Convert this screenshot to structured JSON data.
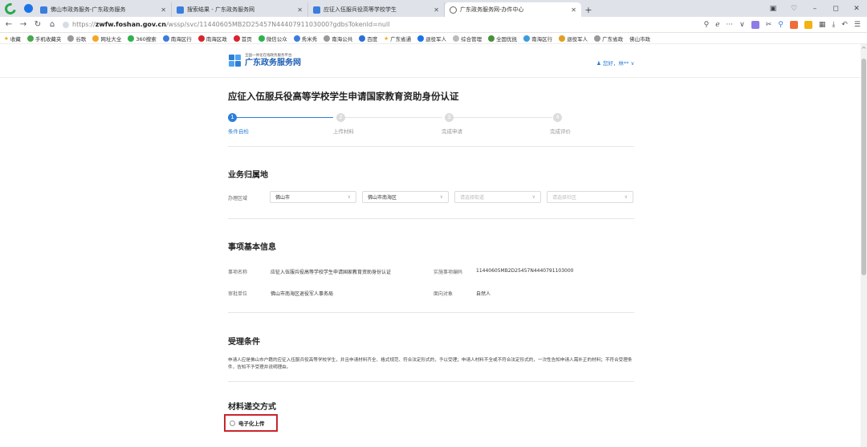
{
  "browser": {
    "tabs": [
      {
        "title": "佛山市政务服务-广东政务服务",
        "active": false
      },
      {
        "title": "搜索结果 - 广东政务服务网",
        "active": false
      },
      {
        "title": "应征入伍服兵役高等学校学生",
        "active": false
      },
      {
        "title": "广东政务服务网-办件中心",
        "active": true
      }
    ],
    "url_prefix": "https://",
    "url_host": "zwfw.foshan.gov.cn",
    "url_path": "/wssp/svc/11440605MB2D25457N4440791103000?gdbsTokenId=null",
    "bookmarks": [
      "收藏",
      "手机收藏夹",
      "谷歌",
      "网址大全",
      "360搜索",
      "南海区行",
      "南海区政",
      "首页",
      "微信公众",
      "秀米秀",
      "南海公共",
      "百度",
      "广东省通",
      "退役军人",
      "综合管理",
      "全国优抚",
      "南海区行",
      "退役军人",
      "广东省政",
      "佛山市政"
    ]
  },
  "site": {
    "logo_small": "全国一体化在线政务服务平台",
    "logo_big": "广东政务服务网",
    "user_label": "您好，林** ∨"
  },
  "page": {
    "title": "应征入伍服兵役高等学校学生申请国家教育资助身份认证",
    "steps": [
      {
        "num": "1",
        "label": "条件自检",
        "active": true
      },
      {
        "num": "2",
        "label": "上传材料",
        "active": false
      },
      {
        "num": "3",
        "label": "完成申请",
        "active": false
      },
      {
        "num": "4",
        "label": "完成评价",
        "active": false
      }
    ],
    "jurisdiction": {
      "title": "业务归属地",
      "label": "办理区域",
      "selects": [
        {
          "value": "佛山市",
          "placeholder": false
        },
        {
          "value": "佛山市南海区",
          "placeholder": false
        },
        {
          "value": "请选择街道",
          "placeholder": true
        },
        {
          "value": "请选择社区",
          "placeholder": true
        }
      ]
    },
    "basic_info": {
      "title": "事项基本信息",
      "item_name_label": "事项名称",
      "item_name": "应征入伍服兵役高等学校学生申请国家教育资助身份认证",
      "code_label": "实施事项编码",
      "code": "11440605MB2D25457N4440791103000",
      "dept_label": "审批单位",
      "dept": "佛山市南海区退役军人事务局",
      "target_label": "面向对象",
      "target": "自然人"
    },
    "conditions": {
      "title": "受理条件",
      "text": "申请人应是佛山市户籍的应征入伍服兵役高等学校学生，并且申请材料齐全、格式规范、符合法定形式的，予以受理；申请人材料不全或不符合法定形式的，一次性告知申请人需补正的材料；不符合受理条件，告知不予受理并说明理由。"
    },
    "submission": {
      "title": "材料递交方式",
      "option": "电子化上传"
    }
  }
}
